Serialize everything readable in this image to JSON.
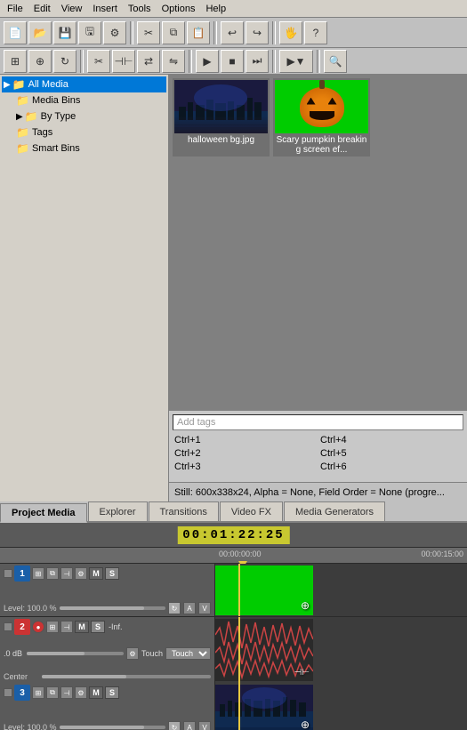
{
  "menubar": {
    "items": [
      "File",
      "Edit",
      "View",
      "Insert",
      "Tools",
      "Options",
      "Help"
    ]
  },
  "toolbar1": {
    "buttons": [
      "new",
      "open",
      "save",
      "saveas",
      "properties",
      "undo-redo-sep",
      "undo",
      "redo",
      "render"
    ]
  },
  "toolbar2": {
    "buttons": [
      "snap",
      "auto-crossfade",
      "loop",
      "cut",
      "trim",
      "slip",
      "play",
      "stop",
      "loop-play",
      "preview",
      "search"
    ]
  },
  "filetree": {
    "items": [
      {
        "label": "All Media",
        "level": 0,
        "selected": true,
        "arrow": "▶"
      },
      {
        "label": "Media Bins",
        "level": 1,
        "arrow": ""
      },
      {
        "label": "By Type",
        "level": 1,
        "arrow": "▶"
      },
      {
        "label": "Tags",
        "level": 1,
        "arrow": ""
      },
      {
        "label": "Smart Bins",
        "level": 1,
        "arrow": ""
      }
    ]
  },
  "media": {
    "items": [
      {
        "id": "halloween",
        "label": "halloween bg.jpg"
      },
      {
        "id": "pumpkin",
        "label": "Scary pumpkin breaking screen ef..."
      }
    ]
  },
  "tags": {
    "placeholder": "Add tags",
    "shortcuts": [
      {
        "key": "Ctrl+1",
        "pos": "left"
      },
      {
        "key": "Ctrl+2",
        "pos": "left"
      },
      {
        "key": "Ctrl+3",
        "pos": "left"
      },
      {
        "key": "Ctrl+4",
        "pos": "right"
      },
      {
        "key": "Ctrl+5",
        "pos": "right"
      },
      {
        "key": "Ctrl+6",
        "pos": "right"
      }
    ]
  },
  "statusbar": {
    "text": "Still: 600x338x24, Alpha = None, Field Order = None (progre..."
  },
  "tabs": [
    {
      "label": "Project Media",
      "active": true
    },
    {
      "label": "Explorer",
      "active": false
    },
    {
      "label": "Transitions",
      "active": false
    },
    {
      "label": "Video FX",
      "active": false
    },
    {
      "label": "Media Generators",
      "active": false
    }
  ],
  "timeline": {
    "timecode": "00:01:22:25",
    "ruler": {
      "time_start": "00:00:00:00",
      "time_end": "00:00:15:00"
    },
    "tracks": [
      {
        "id": 1,
        "type": "video",
        "number": "1",
        "color": "blue",
        "level_label": "Level: 100.0 %",
        "clip_type": "green"
      },
      {
        "id": 2,
        "type": "audio",
        "number": "2",
        "color": "red",
        "db_label": ".0 dB",
        "channel_label": "Center",
        "mode_label": "Touch",
        "inf_label": "-Inf."
      },
      {
        "id": 3,
        "type": "video",
        "number": "3",
        "color": "blue",
        "level_label": "Level: 100.0 %",
        "clip_type": "halloween"
      }
    ]
  }
}
